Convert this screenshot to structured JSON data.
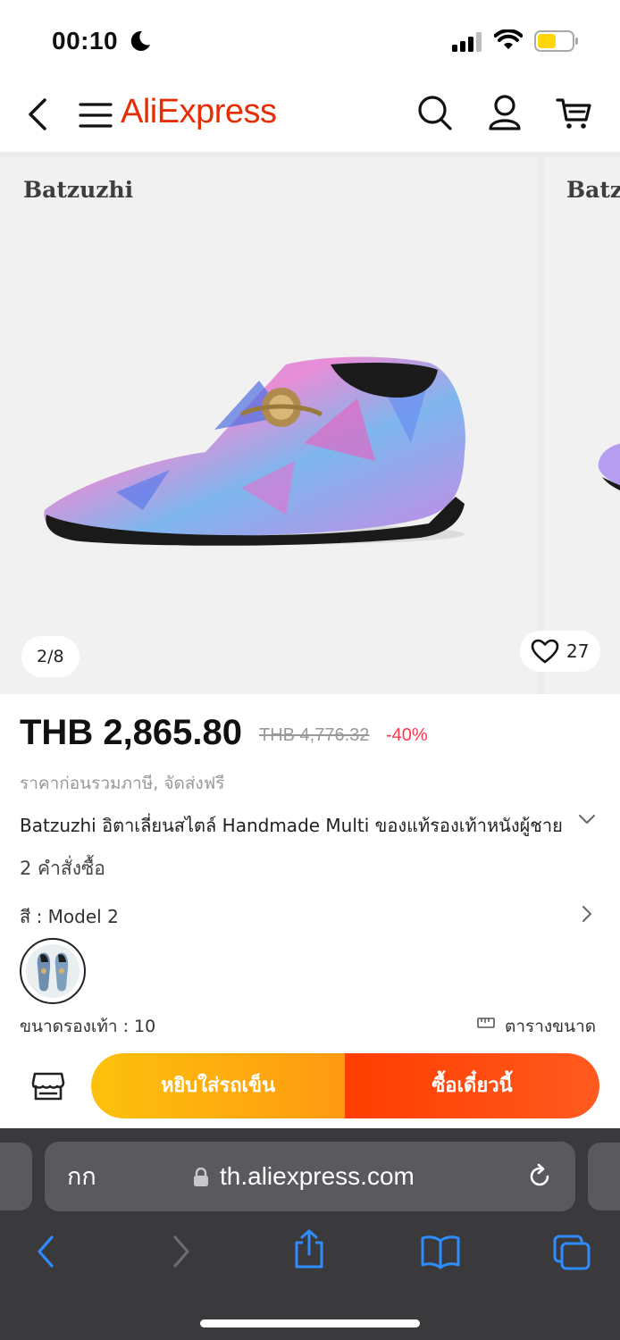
{
  "status_bar": {
    "time": "00:10",
    "icons": [
      "moon-icon",
      "cellular-signal-icon",
      "wifi-icon",
      "battery-icon"
    ],
    "battery_color": "#ffd60a"
  },
  "header": {
    "logo_text": "AliExpress",
    "brand_color": "#e62e04",
    "icons": [
      "back-icon",
      "menu-icon",
      "search-icon",
      "account-icon",
      "cart-icon"
    ]
  },
  "gallery": {
    "brand_watermark": "Batzuzhi",
    "next_slide_watermark": "Batz",
    "pager": "2/8",
    "likes": "27"
  },
  "product": {
    "price": "THB 2,865.80",
    "original_price": "THB 4,776.32",
    "discount": "-40%",
    "tax_note": "ราคาก่อนรวมภาษี, จัดส่งฟรี",
    "title": "Batzuzhi อิตาเลี่ยนสไตล์ Handmade Multi ของแท้รองเท้าหนังผู้ชาย",
    "orders": "2 คำสั่งซื้อ",
    "color_label": "สี : Model 2",
    "size_label": "ขนาดรองเท้า : 10",
    "size_chart": "ตารางขนาด"
  },
  "actions": {
    "add_to_cart": "หยิบใส่รถเข็น",
    "buy_now": "ซื้อเดี๋ยวนี้",
    "add_to_cart_color": "#fdc10c",
    "buy_now_color": "#ff3d00"
  },
  "browser": {
    "text_size_label": "กก",
    "url": "th.aliexpress.com",
    "toolbar_icons": [
      "back-icon",
      "forward-icon",
      "share-icon",
      "bookmarks-icon",
      "tabs-icon"
    ]
  }
}
